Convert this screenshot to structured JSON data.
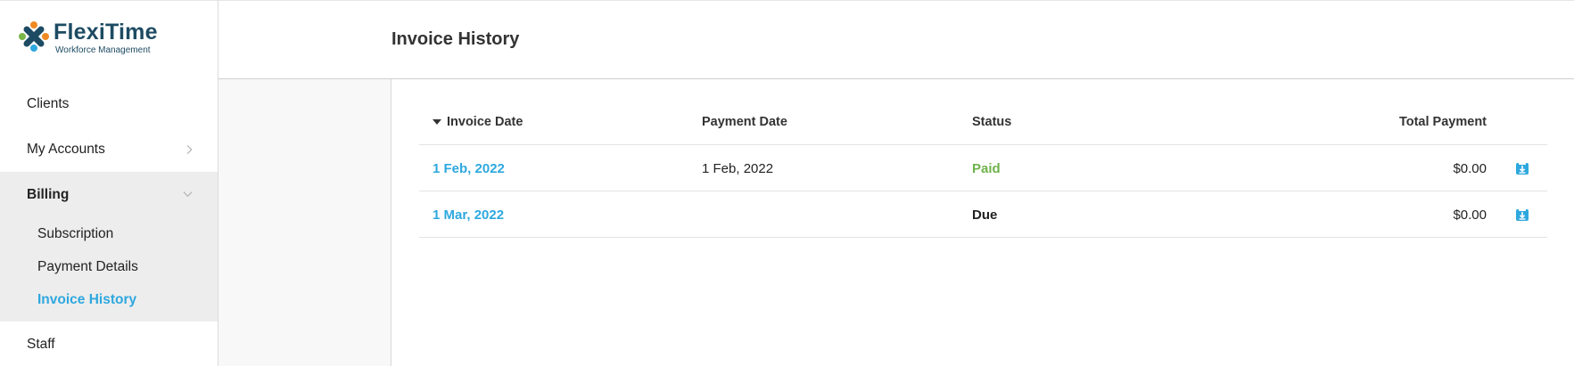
{
  "brand": {
    "name": "FlexiTime",
    "tagline": "Workforce Management",
    "colors": {
      "navy": "#1d4b63",
      "orange": "#f08a24",
      "green": "#7ab648",
      "blue": "#2ea8df"
    }
  },
  "sidebar": {
    "items": [
      {
        "label": "Clients",
        "icon": "none"
      },
      {
        "label": "My Accounts",
        "icon": "chevron-right-icon"
      },
      {
        "label": "Billing",
        "icon": "chevron-down-icon",
        "expanded": true,
        "children": [
          {
            "label": "Subscription"
          },
          {
            "label": "Payment Details"
          },
          {
            "label": "Invoice History",
            "active": true
          }
        ]
      },
      {
        "label": "Staff",
        "icon": "none"
      }
    ]
  },
  "header": {
    "title": "Invoice History"
  },
  "table": {
    "columns": [
      "Invoice Date",
      "Payment Date",
      "Status",
      "Total Payment"
    ],
    "sort": {
      "column": "Invoice Date",
      "direction": "desc"
    },
    "rows": [
      {
        "invoice_date": "1 Feb, 2022",
        "payment_date": "1 Feb, 2022",
        "status": "Paid",
        "total": "$0.00",
        "action_icon": "download-icon"
      },
      {
        "invoice_date": "1 Mar, 2022",
        "payment_date": "",
        "status": "Due",
        "total": "$0.00",
        "action_icon": "download-icon"
      }
    ]
  }
}
